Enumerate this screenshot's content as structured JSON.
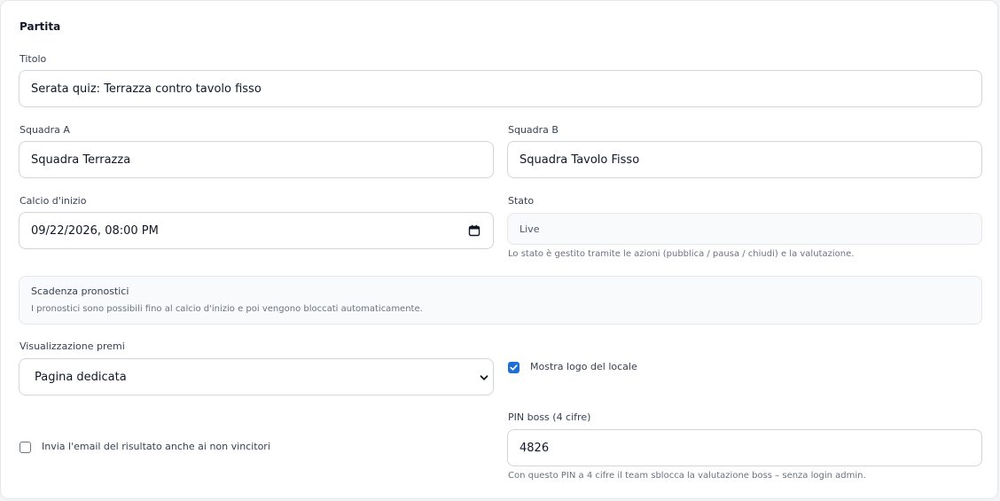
{
  "section": {
    "title": "Partita"
  },
  "fields": {
    "title": {
      "label": "Titolo",
      "value": "Serata quiz: Terrazza contro tavolo fisso"
    },
    "team_a": {
      "label": "Squadra A",
      "value": "Squadra Terrazza"
    },
    "team_b": {
      "label": "Squadra B",
      "value": "Squadra Tavolo Fisso"
    },
    "kickoff": {
      "label": "Calcio d'inizio",
      "value": "09/22/2026, 08:00 PM"
    },
    "status": {
      "label": "Stato",
      "value": "Live",
      "hint": "Lo stato è gestito tramite le azioni (pubblica / pausa / chiudi) e la valutazione."
    },
    "prediction_deadline": {
      "title": "Scadenza pronostici",
      "text": "I pronostici sono possibili fino al calcio d'inizio e poi vengono bloccati automaticamente."
    },
    "prize_display": {
      "label": "Visualizzazione premi",
      "value": "Pagina dedicata"
    },
    "show_logo": {
      "label": "Mostra logo del locale",
      "checked": true
    },
    "send_email": {
      "label": "Invia l'email del risultato anche ai non vincitori",
      "checked": false
    },
    "boss_pin": {
      "label": "PIN boss (4 cifre)",
      "value": "4826",
      "hint": "Con questo PIN a 4 cifre il team sblocca la valutazione boss – senza login admin."
    }
  },
  "icons": {
    "calendar": "calendar-icon",
    "chevron": "chevron-down-icon",
    "check": "check-icon"
  },
  "colors": {
    "accent": "#1d6fd8",
    "border": "#d1d5db",
    "muted_bg": "#f9fafb"
  }
}
